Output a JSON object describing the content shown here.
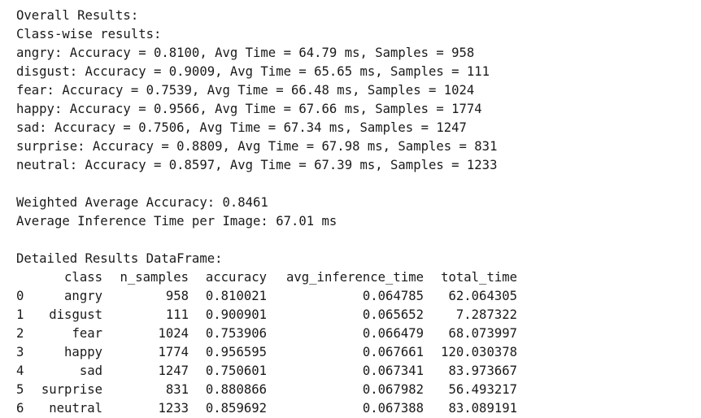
{
  "overall_title": "Overall Results:",
  "classwise_title": "Class-wise results:",
  "classwise": [
    "angry: Accuracy = 0.8100, Avg Time = 64.79 ms, Samples = 958",
    "disgust: Accuracy = 0.9009, Avg Time = 65.65 ms, Samples = 111",
    "fear: Accuracy = 0.7539, Avg Time = 66.48 ms, Samples = 1024",
    "happy: Accuracy = 0.9566, Avg Time = 67.66 ms, Samples = 1774",
    "sad: Accuracy = 0.7506, Avg Time = 67.34 ms, Samples = 1247",
    "surprise: Accuracy = 0.8809, Avg Time = 67.98 ms, Samples = 831",
    "neutral: Accuracy = 0.8597, Avg Time = 67.39 ms, Samples = 1233"
  ],
  "weighted_avg": "Weighted Average Accuracy: 0.8461",
  "avg_inference": "Average Inference Time per Image: 67.01 ms",
  "df_title": "Detailed Results DataFrame:",
  "df": {
    "columns": [
      "",
      "class",
      "n_samples",
      "accuracy",
      "avg_inference_time",
      "total_time"
    ],
    "rows": [
      [
        "0",
        "angry",
        "958",
        "0.810021",
        "0.064785",
        "62.064305"
      ],
      [
        "1",
        "disgust",
        "111",
        "0.900901",
        "0.065652",
        "7.287322"
      ],
      [
        "2",
        "fear",
        "1024",
        "0.753906",
        "0.066479",
        "68.073997"
      ],
      [
        "3",
        "happy",
        "1774",
        "0.956595",
        "0.067661",
        "120.030378"
      ],
      [
        "4",
        "sad",
        "1247",
        "0.750601",
        "0.067341",
        "83.973667"
      ],
      [
        "5",
        "surprise",
        "831",
        "0.880866",
        "0.067982",
        "56.493217"
      ],
      [
        "6",
        "neutral",
        "1233",
        "0.859692",
        "0.067388",
        "83.089191"
      ]
    ]
  }
}
